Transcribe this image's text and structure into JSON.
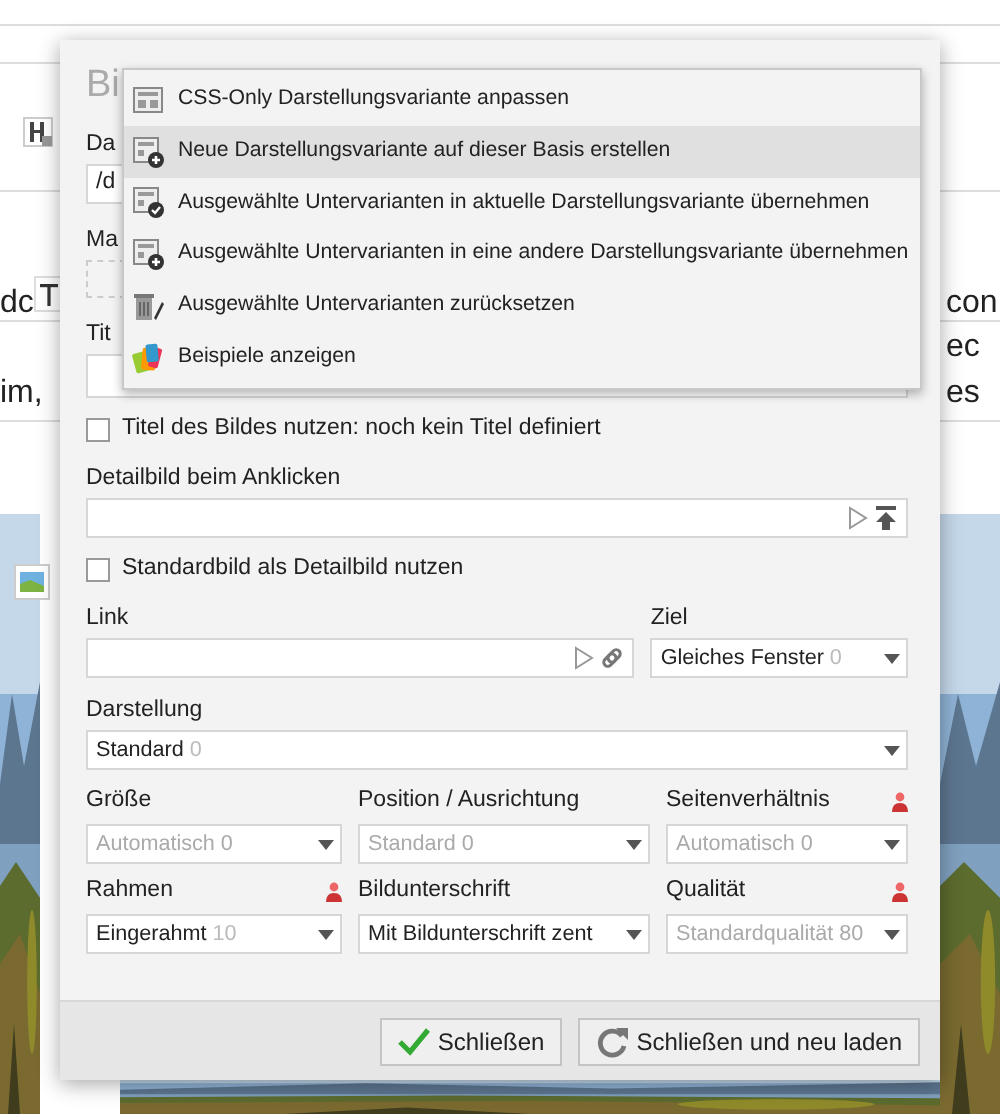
{
  "background": {
    "left_fragments": [
      "dc",
      "im,"
    ],
    "right_fragments": [
      "con",
      "ec",
      "es"
    ]
  },
  "dialog": {
    "title": "Bi",
    "top_fields": [
      {
        "label": "Da",
        "value": "/d",
        "kind": "input"
      },
      {
        "label": "Ma",
        "kind": "dropzone"
      },
      {
        "label": "Tit",
        "kind": "input"
      }
    ],
    "menu": [
      {
        "label": "CSS-Only Darstellungsvariante anpassen",
        "kind": "layout",
        "selected": false
      },
      {
        "label": "Neue Darstellungsvariante auf dieser Basis erstellen",
        "kind": "layout-plus",
        "selected": true
      },
      {
        "label": "Ausgewählte Untervarianten in aktuelle Darstellungsvariante übernehmen",
        "kind": "layout-check",
        "selected": false
      },
      {
        "label": "Ausgewählte Untervarianten in eine andere Darstellungsvariante übernehmen",
        "kind": "layout-plus",
        "selected": false
      },
      {
        "label": "Ausgewählte Untervarianten zurücksetzen",
        "kind": "trash",
        "selected": false
      },
      {
        "label": "Beispiele anzeigen",
        "kind": "palette",
        "selected": false
      }
    ],
    "use_title": {
      "label": "Titel des Bildes nutzen: noch kein Titel definiert",
      "checked": false
    },
    "detail_image": {
      "label": "Detailbild beim Anklicken"
    },
    "use_default": {
      "label": "Standardbild als Detailbild nutzen",
      "checked": false
    },
    "link": {
      "label": "Link"
    },
    "target": {
      "label": "Ziel",
      "value": "Gleiches Fenster",
      "count": "0",
      "inherited": false
    },
    "display": {
      "label": "Darstellung",
      "value": "Standard",
      "count": "0",
      "inherited": false
    },
    "selects": [
      {
        "label": "Größe",
        "value": "Automatisch 0",
        "inherited": true,
        "marker": false
      },
      {
        "label": "Position / Ausrichtung",
        "value": "Standard 0",
        "inherited": true,
        "marker": false
      },
      {
        "label": "Seitenverhältnis",
        "value": "Automatisch 0",
        "inherited": true,
        "marker": true
      },
      {
        "label": "Rahmen",
        "value": "Eingerahmt",
        "count": "10",
        "inherited": false,
        "marker": true
      },
      {
        "label": "Bildunterschrift",
        "value": "Mit Bildunterschrift zent",
        "inherited": false,
        "marker": false
      },
      {
        "label": "Qualität",
        "value": "Standardqualität 80",
        "inherited": true,
        "marker": true
      }
    ],
    "buttons": [
      {
        "label": "Schließen",
        "kind": "check"
      },
      {
        "label": "Schließen und neu laden",
        "kind": "reload"
      }
    ]
  }
}
